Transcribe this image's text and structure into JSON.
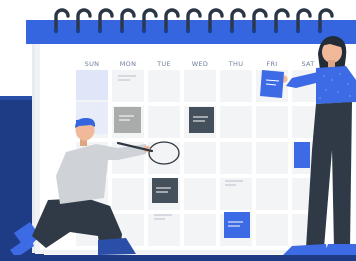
{
  "calendar": {
    "weekdays": [
      "SUN",
      "MON",
      "TUE",
      "WED",
      "THU",
      "FRI",
      "SAT"
    ]
  },
  "colors": {
    "accent_blue": "#3d6be6",
    "navy": "#1e3c86",
    "binding_blue": "#3566e0",
    "sticky_gray": "#a9acab",
    "sticky_dark": "#44505c",
    "sticky_blue": "#3d6be6",
    "pants": "#2f3a46"
  }
}
